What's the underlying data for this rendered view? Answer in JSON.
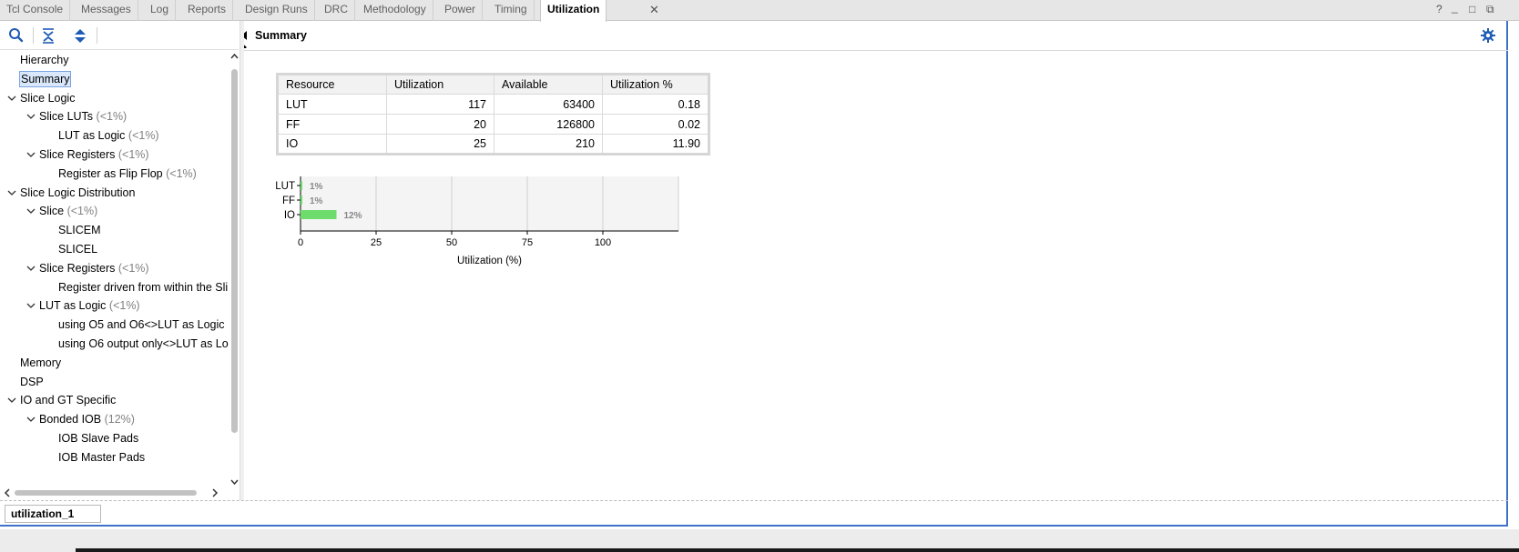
{
  "tabs": [
    {
      "label": "Tcl Console",
      "active": false
    },
    {
      "label": "Messages",
      "active": false
    },
    {
      "label": "Log",
      "active": false
    },
    {
      "label": "Reports",
      "active": false
    },
    {
      "label": "Design Runs",
      "active": false
    },
    {
      "label": "DRC",
      "active": false
    },
    {
      "label": "Methodology",
      "active": false
    },
    {
      "label": "Power",
      "active": false
    },
    {
      "label": "Timing",
      "active": false
    },
    {
      "label": "Utilization",
      "active": true
    }
  ],
  "tab_close_icon": "close-icon",
  "window_controls": {
    "help": "?",
    "minimize": "_",
    "maximize": "□",
    "popout": "⧉"
  },
  "toolbar_icons": [
    "search-icon",
    "collapse-all-icon",
    "expand-all-icon"
  ],
  "tree": [
    {
      "label": "Hierarchy",
      "pct": "",
      "level": 0,
      "expandable": false
    },
    {
      "label": "Summary",
      "pct": "",
      "level": 0,
      "expandable": false,
      "selected": true
    },
    {
      "label": "Slice Logic",
      "pct": "",
      "level": 0,
      "expandable": true
    },
    {
      "label": "Slice LUTs",
      "pct": "(<1%)",
      "level": 1,
      "expandable": true
    },
    {
      "label": "LUT as Logic",
      "pct": "(<1%)",
      "level": 2,
      "expandable": false
    },
    {
      "label": "Slice Registers",
      "pct": "(<1%)",
      "level": 1,
      "expandable": true
    },
    {
      "label": "Register as Flip Flop",
      "pct": "(<1%)",
      "level": 2,
      "expandable": false
    },
    {
      "label": "Slice Logic Distribution",
      "pct": "",
      "level": 0,
      "expandable": true
    },
    {
      "label": "Slice",
      "pct": "(<1%)",
      "level": 1,
      "expandable": true
    },
    {
      "label": "SLICEM",
      "pct": "",
      "level": 2,
      "expandable": false
    },
    {
      "label": "SLICEL",
      "pct": "",
      "level": 2,
      "expandable": false
    },
    {
      "label": "Slice Registers",
      "pct": "(<1%)",
      "level": 1,
      "expandable": true
    },
    {
      "label": "Register driven from within the Sli",
      "pct": "",
      "level": 2,
      "expandable": false
    },
    {
      "label": "LUT as Logic",
      "pct": "(<1%)",
      "level": 1,
      "expandable": true
    },
    {
      "label": "using O5 and O6<>LUT as Logic",
      "pct": "",
      "level": 2,
      "expandable": false
    },
    {
      "label": "using O6 output only<>LUT as Lo",
      "pct": "",
      "level": 2,
      "expandable": false
    },
    {
      "label": "Memory",
      "pct": "",
      "level": 0,
      "expandable": false
    },
    {
      "label": "DSP",
      "pct": "",
      "level": 0,
      "expandable": false
    },
    {
      "label": "IO and GT Specific",
      "pct": "",
      "level": 0,
      "expandable": true
    },
    {
      "label": "Bonded IOB",
      "pct": "(12%)",
      "level": 1,
      "expandable": true
    },
    {
      "label": "IOB Slave Pads",
      "pct": "",
      "level": 2,
      "expandable": false
    },
    {
      "label": "IOB Master Pads",
      "pct": "",
      "level": 2,
      "expandable": false
    }
  ],
  "right_pane": {
    "title": "Summary",
    "settings_icon": "gear-icon"
  },
  "table": {
    "headers": [
      "Resource",
      "Utilization",
      "Available",
      "Utilization %"
    ],
    "rows": [
      [
        "LUT",
        "117",
        "63400",
        "0.18"
      ],
      [
        "FF",
        "20",
        "126800",
        "0.02"
      ],
      [
        "IO",
        "25",
        "210",
        "11.90"
      ]
    ]
  },
  "chart_data": {
    "type": "bar",
    "orientation": "horizontal",
    "categories": [
      "LUT",
      "FF",
      "IO"
    ],
    "values": [
      0.18,
      0.02,
      11.9
    ],
    "data_labels": [
      "1%",
      "1%",
      "12%"
    ],
    "xlabel": "Utilization (%)",
    "ylabel": "",
    "xticks": [
      0,
      25,
      50,
      75,
      100
    ],
    "xlim": [
      0,
      125
    ],
    "grid": true,
    "bar_color": "#6ddc6d",
    "plot_background": "#f4f4f4"
  },
  "bottom_tab": {
    "label": "utilization_1"
  },
  "colors": {
    "accent": "#3f72c8",
    "selected_bg": "#d9e8fb"
  }
}
